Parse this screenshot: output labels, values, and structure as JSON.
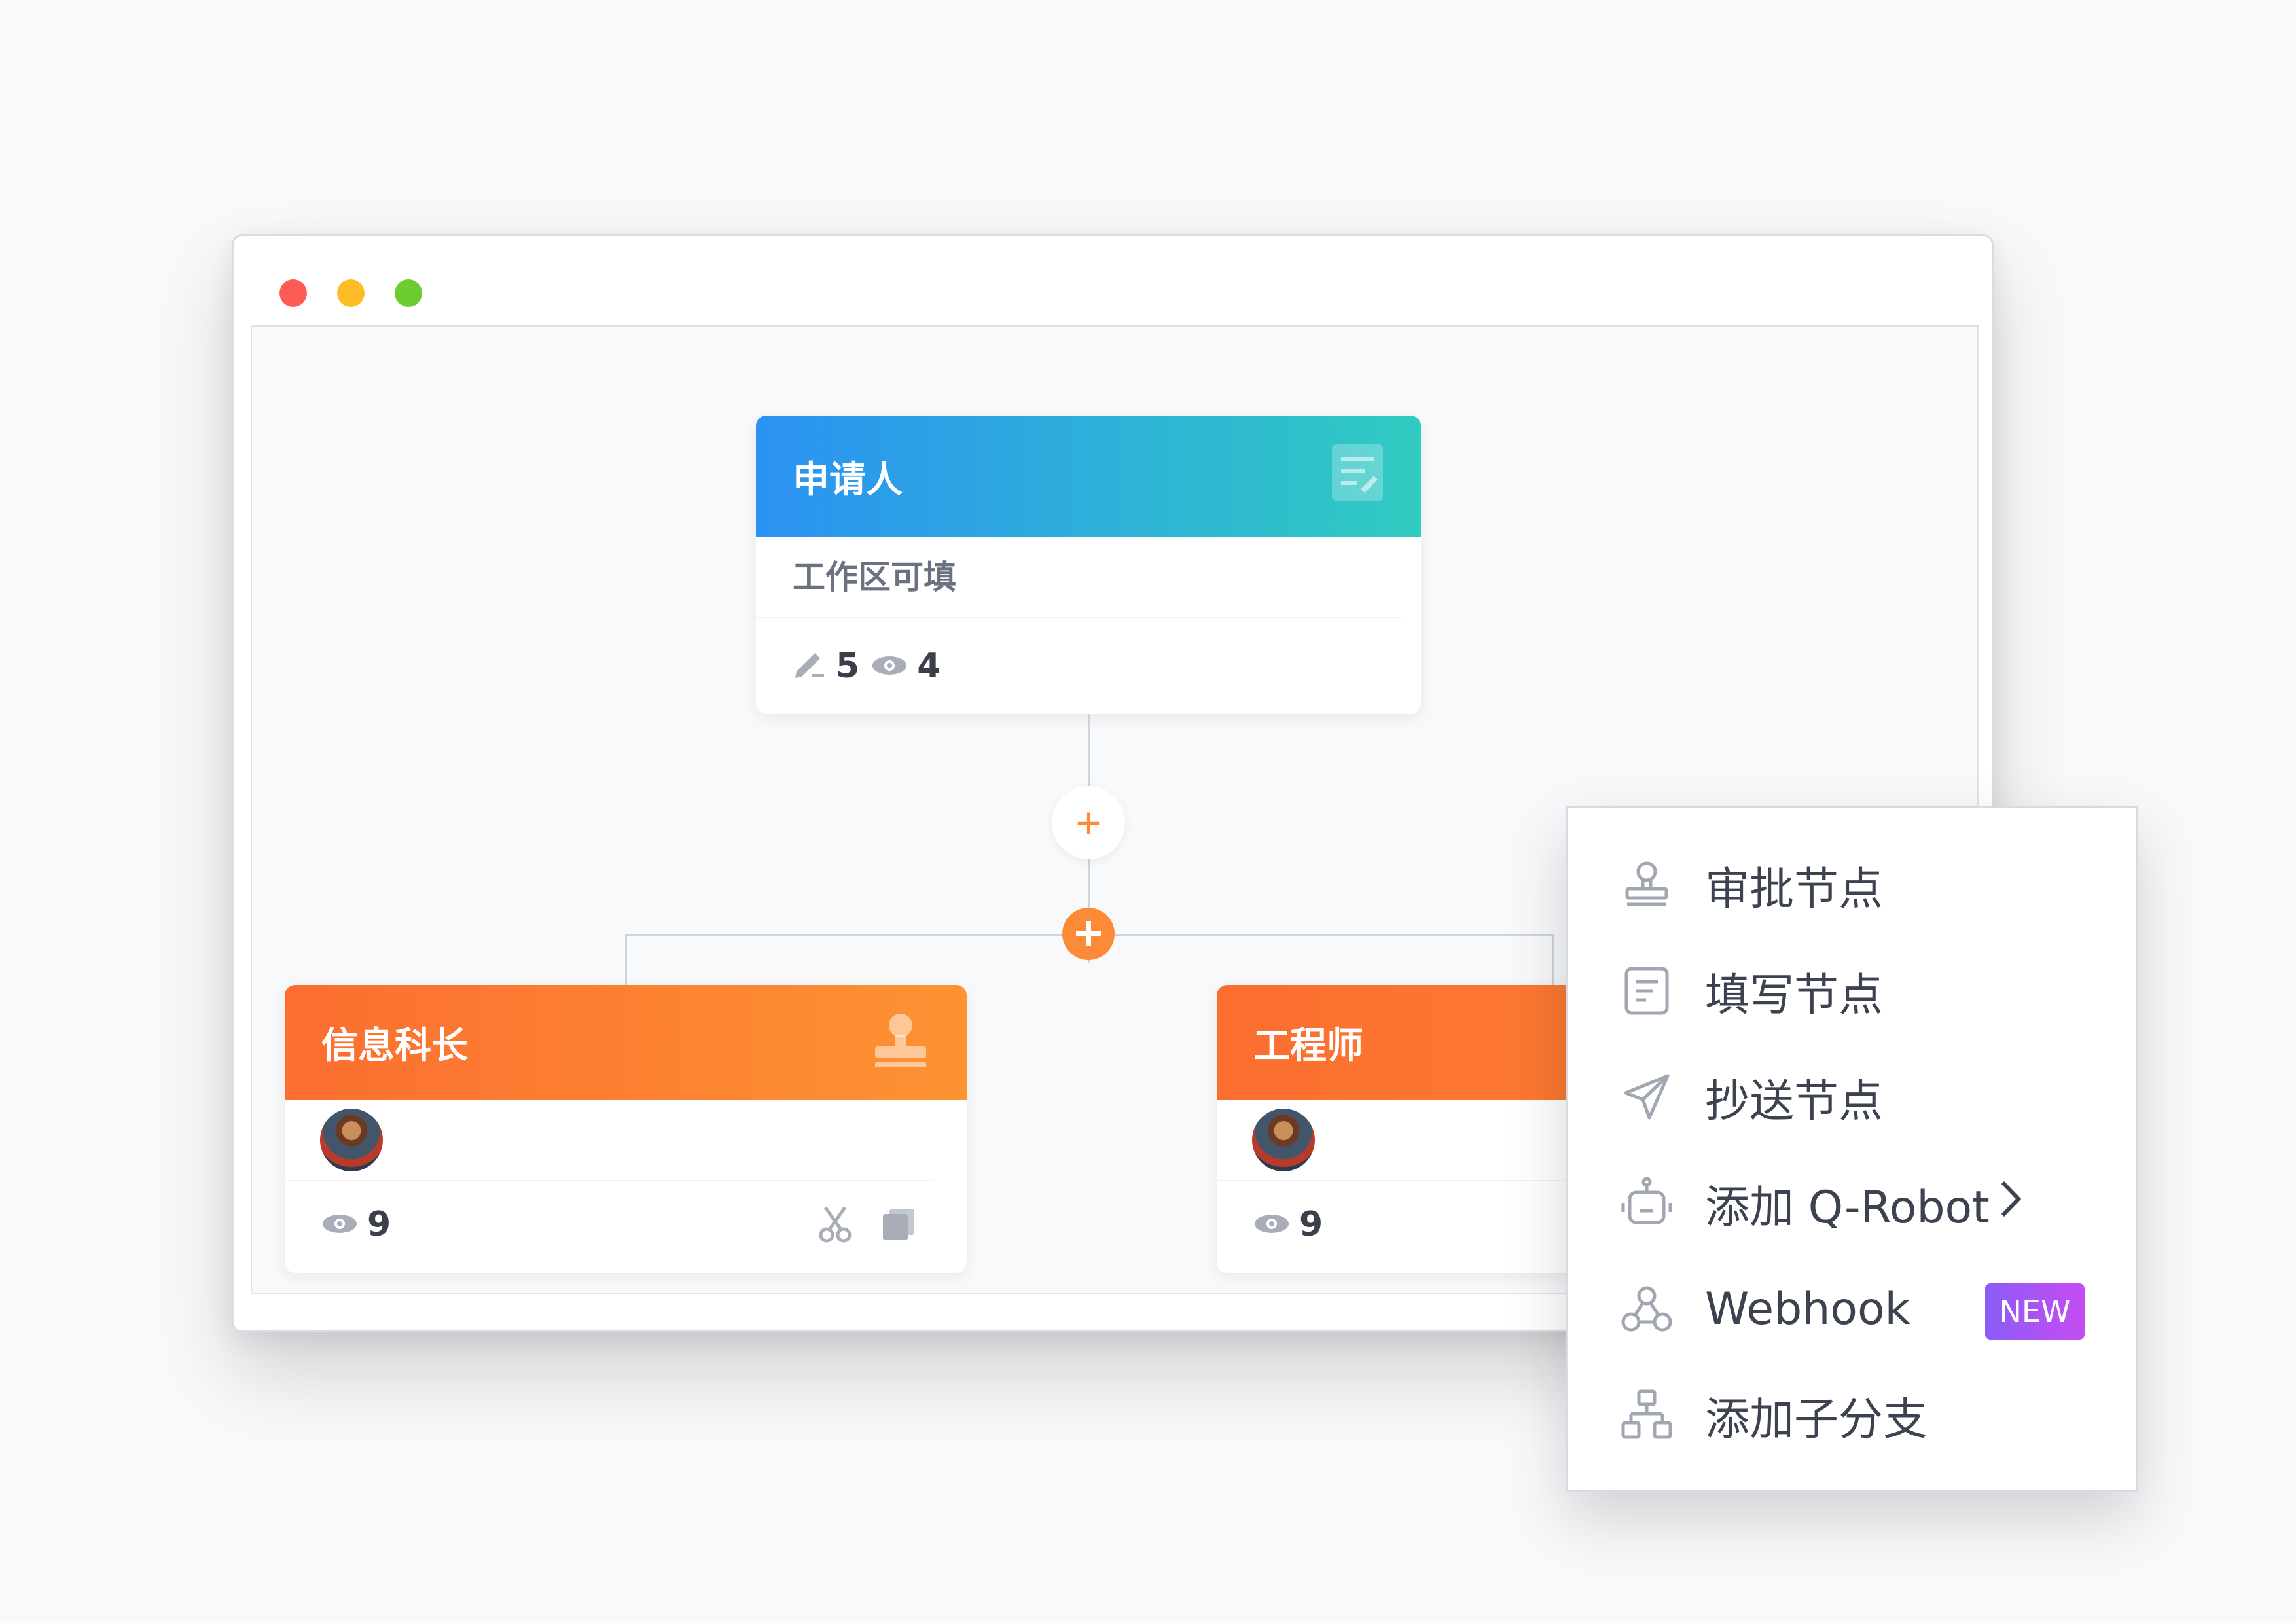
{
  "window": {
    "traffic_lights": [
      "red",
      "yellow",
      "green"
    ]
  },
  "nodes": {
    "applicant": {
      "title": "申请人",
      "subtitle": "工作区可填",
      "edit_count": "5",
      "view_count": "4",
      "header_icon": "form-icon"
    },
    "info_chief": {
      "title": "信息科长",
      "view_count": "9",
      "header_icon": "stamp-icon"
    },
    "engineer": {
      "title": "工程师",
      "view_count": "9"
    }
  },
  "connector": {
    "add_symbol": "+"
  },
  "menu": {
    "items": [
      {
        "label": "审批节点",
        "icon": "stamp-icon"
      },
      {
        "label": "填写节点",
        "icon": "form-icon"
      },
      {
        "label": "抄送节点",
        "icon": "send-icon"
      },
      {
        "label": "添加 Q-Robot",
        "icon": "robot-icon",
        "chevron": ">"
      },
      {
        "label": "Webhook",
        "icon": "webhook-icon",
        "badge": "NEW"
      },
      {
        "label": "添加子分支",
        "icon": "branch-icon"
      }
    ]
  },
  "colors": {
    "accent_orange": "#fd8a36",
    "header_blue_start": "#2b92f2",
    "header_blue_end": "#30cbc1",
    "badge_purple": "#8b5cf6"
  }
}
